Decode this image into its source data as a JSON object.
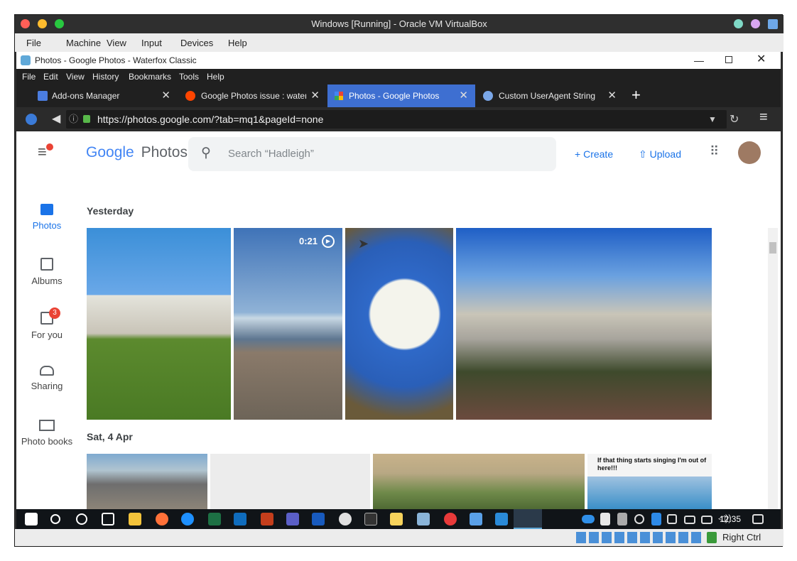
{
  "vbox": {
    "title": "Windows [Running] - Oracle VM VirtualBox",
    "menu": [
      "File",
      "Machine",
      "View",
      "Input",
      "Devices",
      "Help"
    ],
    "host_key": "Right Ctrl"
  },
  "browser": {
    "window_title": "Photos - Google Photos - Waterfox Classic",
    "menu": [
      "File",
      "Edit",
      "View",
      "History",
      "Bookmarks",
      "Tools",
      "Help"
    ],
    "tabs": [
      {
        "label": "Add-ons Manager"
      },
      {
        "label": "Google Photos issue : waterf"
      },
      {
        "label": "Photos - Google Photos"
      },
      {
        "label": "Custom UserAgent String"
      }
    ],
    "url": "https://photos.google.com/?tab=mq1&pageId=none"
  },
  "gphotos": {
    "logo_google": "Google",
    "logo_photos": "Photos",
    "search_placeholder": "Search “Hadleigh”",
    "create_label": "Create",
    "upload_label": "Upload",
    "nav": [
      {
        "label": "Photos",
        "icon": "image-icon"
      },
      {
        "label": "Albums",
        "icon": "albums-icon"
      },
      {
        "label": "For you",
        "icon": "for-you-icon",
        "badge": "3"
      },
      {
        "label": "Sharing",
        "icon": "people-icon"
      },
      {
        "label": "Photo books",
        "icon": "book-icon"
      }
    ],
    "sections": [
      {
        "heading": "Yesterday",
        "video_duration": "0:21"
      },
      {
        "heading": "Sat, 4 Apr",
        "caption": "If that thing starts singing I'm out of here!!!"
      }
    ]
  },
  "taskbar": {
    "clock": "12:35"
  },
  "colors": {
    "accent": "#1a73e8",
    "active_tab": "#3e6fd1",
    "taskbar": "#101418"
  }
}
